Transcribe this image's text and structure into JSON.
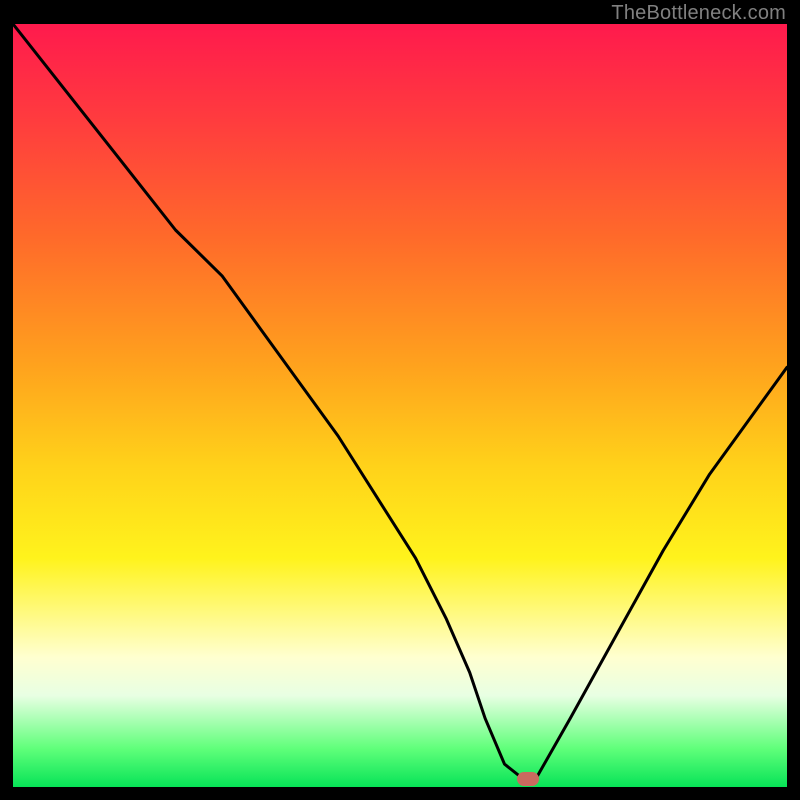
{
  "watermark": "TheBottleneck.com",
  "colors": {
    "frame": "#000000",
    "curve": "#000000",
    "marker": "#c96a5f"
  },
  "chart_data": {
    "type": "line",
    "title": "",
    "xlabel": "",
    "ylabel": "",
    "xlim": [
      0,
      100
    ],
    "ylim": [
      0,
      100
    ],
    "grid": false,
    "legend": false,
    "series": [
      {
        "name": "bottleneck-curve",
        "x": [
          0,
          7,
          14,
          21,
          27,
          32,
          37,
          42,
          47,
          52,
          56,
          59,
          61,
          63.5,
          66,
          67.5,
          72,
          78,
          84,
          90,
          95,
          100
        ],
        "values": [
          100,
          91,
          82,
          73,
          67,
          60,
          53,
          46,
          38,
          30,
          22,
          15,
          9,
          3,
          1,
          1,
          9,
          20,
          31,
          41,
          48,
          55
        ]
      }
    ],
    "marker": {
      "x": 66.5,
      "y": 1
    }
  }
}
